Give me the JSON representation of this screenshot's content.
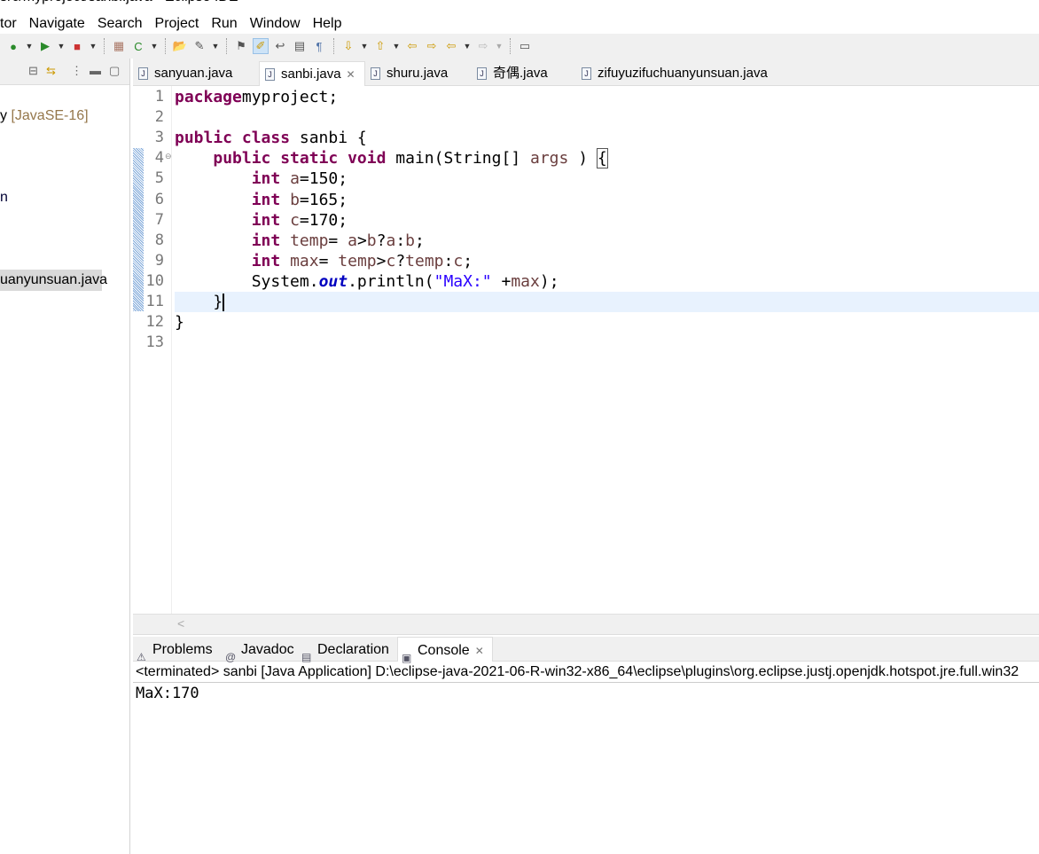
{
  "window": {
    "title": "src/myproject/sanbi.java - Eclipse IDE"
  },
  "menu": [
    "tor",
    "Navigate",
    "Search",
    "Project",
    "Run",
    "Window",
    "Help"
  ],
  "left_panel": {
    "items": [
      {
        "text": "y ",
        "suffix": "[JavaSE-16]"
      },
      {
        "text": "n"
      },
      {
        "text": "uanyunsuan.java"
      }
    ]
  },
  "tabs": [
    {
      "label": "sanyuan.java",
      "active": false
    },
    {
      "label": "sanbi.java",
      "active": true,
      "close": "✕"
    },
    {
      "label": "shuru.java",
      "active": false
    },
    {
      "label": "奇偶.java",
      "active": false
    },
    {
      "label": "zifuyuzifuchuanyunsuan.java",
      "active": false
    }
  ],
  "code": [
    [
      [
        "kw",
        "package"
      ],
      [
        "",
        "myproject;"
      ]
    ],
    [],
    [
      [
        "kw",
        "public class"
      ],
      [
        "",
        " sanbi {"
      ]
    ],
    [
      [
        "",
        "    "
      ],
      [
        "kw",
        "public static void"
      ],
      [
        "",
        " main(String[] "
      ],
      [
        "var",
        "args"
      ],
      [
        "",
        " ) "
      ],
      [
        "brk",
        "{"
      ]
    ],
    [
      [
        "",
        "        "
      ],
      [
        "kw",
        "int"
      ],
      [
        "",
        " "
      ],
      [
        "var",
        "a"
      ],
      [
        "",
        "=150;"
      ]
    ],
    [
      [
        "",
        "        "
      ],
      [
        "kw",
        "int"
      ],
      [
        "",
        " "
      ],
      [
        "var",
        "b"
      ],
      [
        "",
        "=165;"
      ]
    ],
    [
      [
        "",
        "        "
      ],
      [
        "kw",
        "int"
      ],
      [
        "",
        " "
      ],
      [
        "var",
        "c"
      ],
      [
        "",
        "=170;"
      ]
    ],
    [
      [
        "",
        "        "
      ],
      [
        "kw",
        "int"
      ],
      [
        "",
        " "
      ],
      [
        "var",
        "temp"
      ],
      [
        "",
        "= "
      ],
      [
        "var",
        "a"
      ],
      [
        "",
        ">"
      ],
      [
        "var",
        "b"
      ],
      [
        "",
        "?"
      ],
      [
        "var",
        "a"
      ],
      [
        "",
        ":"
      ],
      [
        "var",
        "b"
      ],
      [
        "",
        ";"
      ]
    ],
    [
      [
        "",
        "        "
      ],
      [
        "kw",
        "int"
      ],
      [
        "",
        " "
      ],
      [
        "var",
        "max"
      ],
      [
        "",
        "= "
      ],
      [
        "var",
        "temp"
      ],
      [
        "",
        ">"
      ],
      [
        "var",
        "c"
      ],
      [
        "",
        "?"
      ],
      [
        "var",
        "temp"
      ],
      [
        "",
        ":"
      ],
      [
        "var",
        "c"
      ],
      [
        "",
        ";"
      ]
    ],
    [
      [
        "",
        "        System."
      ],
      [
        "fld",
        "out"
      ],
      [
        "",
        ".println("
      ],
      [
        "str",
        "\"MaX:\""
      ],
      [
        "",
        " +"
      ],
      [
        "var",
        "max"
      ],
      [
        "",
        ");"
      ]
    ],
    [
      [
        "",
        "    }"
      ]
    ],
    [
      [
        "",
        "}"
      ]
    ],
    []
  ],
  "current_line": 11,
  "bottom_tabs": [
    {
      "label": "Problems",
      "icon": "problems-icon"
    },
    {
      "label": "Javadoc",
      "icon": "at-icon"
    },
    {
      "label": "Declaration",
      "icon": "declaration-icon"
    },
    {
      "label": "Console",
      "icon": "console-icon",
      "active": true,
      "close": "✕"
    }
  ],
  "console": {
    "header": "<terminated> sanbi [Java Application] D:\\eclipse-java-2021-06-R-win32-x86_64\\eclipse\\plugins\\org.eclipse.justj.openjdk.hotspot.jre.full.win32",
    "output": "MaX:170"
  }
}
